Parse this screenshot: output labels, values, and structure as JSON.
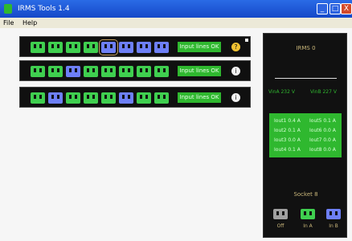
{
  "window": {
    "title": "IRMS Tools 1.4",
    "minimize": "_",
    "maximize": "□",
    "close": "X"
  },
  "menu": {
    "file": "File",
    "help": "Help"
  },
  "rows": [
    {
      "status": "Input lines OK",
      "info": "?",
      "sockets": [
        "green",
        "green",
        "green",
        "green",
        "blue",
        "blue",
        "blue",
        "blue"
      ],
      "selected_index": 4
    },
    {
      "status": "Input lines OK",
      "info": "i",
      "sockets": [
        "green",
        "green",
        "blue",
        "green",
        "green",
        "green",
        "green",
        "green"
      ],
      "selected_index": null
    },
    {
      "status": "Input lines OK",
      "info": "i",
      "sockets": [
        "green",
        "blue",
        "green",
        "green",
        "green",
        "blue",
        "green",
        "green"
      ],
      "selected_index": null
    }
  ],
  "side_panel": {
    "title": "IRMS 0",
    "vin_a": "VinA 232 V",
    "vin_b": "VinB 227 V",
    "readings": [
      {
        "left": "Iout1 0.4 A",
        "right": "Iout5 0.1 A"
      },
      {
        "left": "Iout2 0.1 A",
        "right": "Iout6 0.0 A"
      },
      {
        "left": "Iout3 0.0 A",
        "right": "Iout7 0.0 A"
      },
      {
        "left": "Iout4 0.1 A",
        "right": "Iout8 0.0 A"
      }
    ],
    "socket_title": "Socket 8",
    "legend": [
      {
        "label": "Off",
        "color": "#a0a0a0"
      },
      {
        "label": "In A",
        "color": "#3fcf4f"
      },
      {
        "label": "In B",
        "color": "#6d7ff6"
      }
    ]
  },
  "colors": {
    "green": "#3fcf4f",
    "blue": "#6d7ff6",
    "panel_bg": "#101010",
    "status_bg": "#2fb82f"
  }
}
